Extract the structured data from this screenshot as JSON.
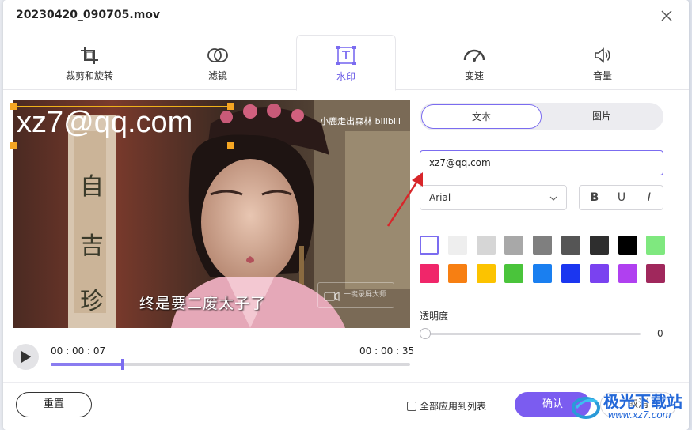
{
  "window": {
    "title": "20230420_090705.mov"
  },
  "tabs": [
    {
      "id": "crop",
      "label": "裁剪和旋转",
      "icon": "crop-icon",
      "active": false
    },
    {
      "id": "filter",
      "label": "滤镜",
      "icon": "filter-icon",
      "active": false
    },
    {
      "id": "watermark",
      "label": "水印",
      "icon": "text-watermark-icon",
      "active": true
    },
    {
      "id": "speed",
      "label": "变速",
      "icon": "speedometer-icon",
      "active": false
    },
    {
      "id": "volume",
      "label": "音量",
      "icon": "speaker-icon",
      "active": false
    }
  ],
  "preview": {
    "watermark_text": "xz7@qq.com",
    "channel_logo": "小鹿走出森林 bilibili",
    "subtitle": "终是要二废太子了",
    "recorder_badge": "一键录屏大师"
  },
  "player": {
    "current_time": "00 : 00 : 07",
    "total_time": "00 : 00 : 35",
    "progress": 0.2
  },
  "watermark_panel": {
    "type_options": [
      "文本",
      "图片"
    ],
    "selected_type": "文本",
    "text_value": "xz7@qq.com",
    "font": "Arial",
    "style_buttons": [
      "B",
      "U",
      "I"
    ],
    "colors": [
      "#ffffff",
      "#eeeeee",
      "#d6d6d6",
      "#a8a8a8",
      "#7f7f7f",
      "#555555",
      "#2e2e2e",
      "#000000",
      "#7fe87f",
      "#f0266a",
      "#f77f12",
      "#fcc300",
      "#4ac43b",
      "#1a7ff0",
      "#1b36f0",
      "#7a42f0",
      "#b040f0",
      "#a0285c"
    ],
    "selected_color_index": 0,
    "opacity_label": "透明度",
    "opacity_value": "0"
  },
  "footer": {
    "reset_label": "重置",
    "apply_all_label": "全部应用到列表",
    "apply_all_checked": false,
    "confirm_label": "确认",
    "cancel_label": "取消"
  },
  "site_watermark": {
    "name": "极光下载站",
    "url": "www.xz7.com"
  }
}
